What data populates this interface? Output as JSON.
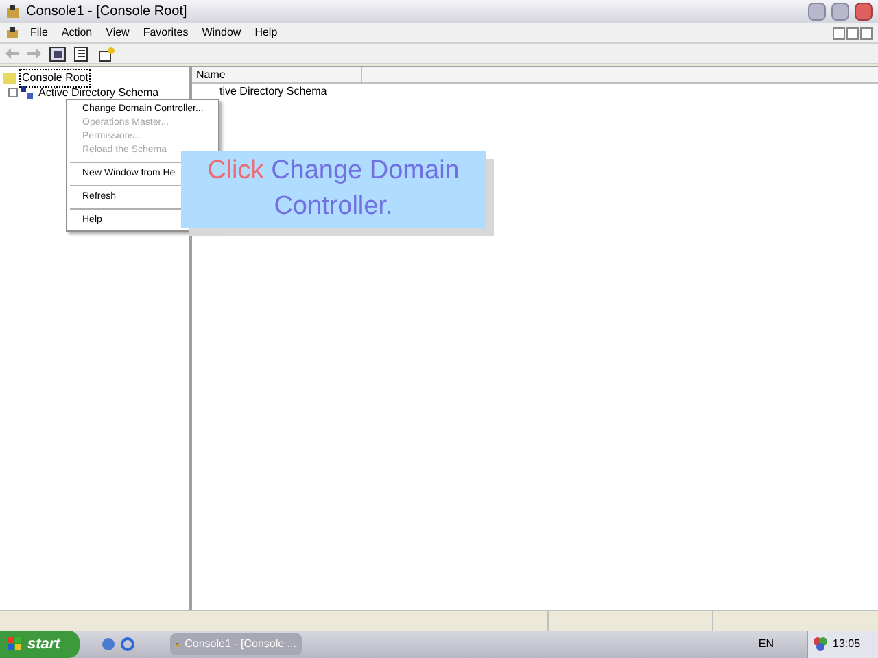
{
  "window": {
    "title": "Console1 - [Console Root]"
  },
  "menu_bar": [
    {
      "label": "File"
    },
    {
      "label": "Action"
    },
    {
      "label": "View"
    },
    {
      "label": "Favorites"
    },
    {
      "label": "Window"
    },
    {
      "label": "Help"
    }
  ],
  "tree": [
    {
      "label": "Console Root",
      "selected": true,
      "children": [
        {
          "label": "Active Directory Schema",
          "selected": false
        }
      ]
    }
  ],
  "list": {
    "columns": [
      "Name"
    ],
    "rows": [
      "tive Directory Schema"
    ]
  },
  "context_menu": [
    {
      "kind": "item",
      "label": "Change Domain Controller...",
      "disabled": false
    },
    {
      "kind": "item",
      "label": "Operations Master...",
      "disabled": true
    },
    {
      "kind": "item",
      "label": "Permissions...",
      "disabled": true
    },
    {
      "kind": "item",
      "label": "Reload the Schema",
      "disabled": true
    },
    {
      "kind": "separator"
    },
    {
      "kind": "item",
      "label": "New Window from He",
      "disabled": false
    },
    {
      "kind": "separator"
    },
    {
      "kind": "item",
      "label": "Refresh",
      "disabled": false
    },
    {
      "kind": "separator"
    },
    {
      "kind": "item",
      "label": "Help",
      "disabled": false
    }
  ],
  "callout": {
    "action": "Click",
    "target": "Change Domain Controller."
  },
  "taskbar": {
    "start": "start",
    "task": "Console1 - [Console ...",
    "language": "EN",
    "clock": "13:05"
  }
}
